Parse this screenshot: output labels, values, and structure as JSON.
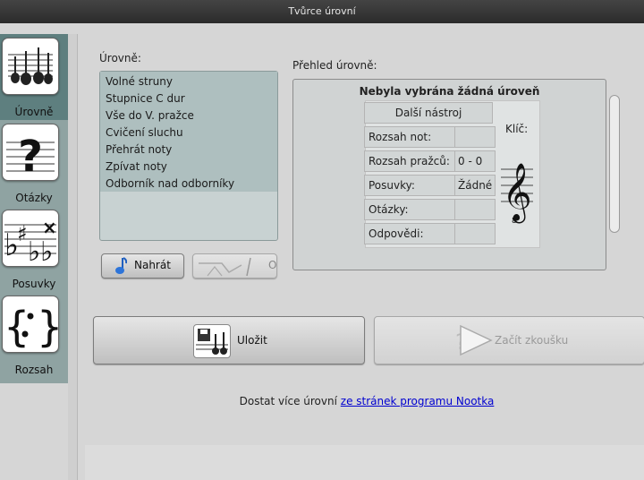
{
  "window": {
    "title": "Tvůrce úrovní"
  },
  "sidebar": {
    "items": [
      {
        "label": "Úrovně",
        "icon": "guitar-icon",
        "active": true
      },
      {
        "label": "Otázky",
        "icon": "question-mark-icon",
        "active": false
      },
      {
        "label": "Posuvky",
        "icon": "accidentals-icon",
        "active": false
      },
      {
        "label": "Rozsah",
        "icon": "braces-icon",
        "active": false
      }
    ]
  },
  "levels": {
    "label": "Úrovně:",
    "items": [
      "Volné struny",
      "Stupnice C dur",
      "Vše do V. pražce",
      "Cvičení sluchu",
      "Přehrát noty",
      "Zpívat noty",
      "Odborník nad odborníky"
    ],
    "load_button": "Nahrát",
    "remove_button_partial": "O"
  },
  "overview": {
    "label": "Přehled úrovně:",
    "title": "Nebyla vybrána žádná úroveň",
    "instrument": "Další nástroj",
    "rows": [
      {
        "label": "Rozsah not:",
        "value": ""
      },
      {
        "label": "Rozsah pražců:",
        "value": "0 - 0"
      },
      {
        "label": "Posuvky:",
        "value": "Žádné"
      },
      {
        "label": "Otázky:",
        "value": ""
      },
      {
        "label": "Odpovědi:",
        "value": ""
      }
    ],
    "clef_label": "Klíč:"
  },
  "actions": {
    "save": "Uložit",
    "start": "Začít zkoušku"
  },
  "footer": {
    "text": "Dostat více úrovní",
    "link": "ze stránek programu Nootka"
  }
}
